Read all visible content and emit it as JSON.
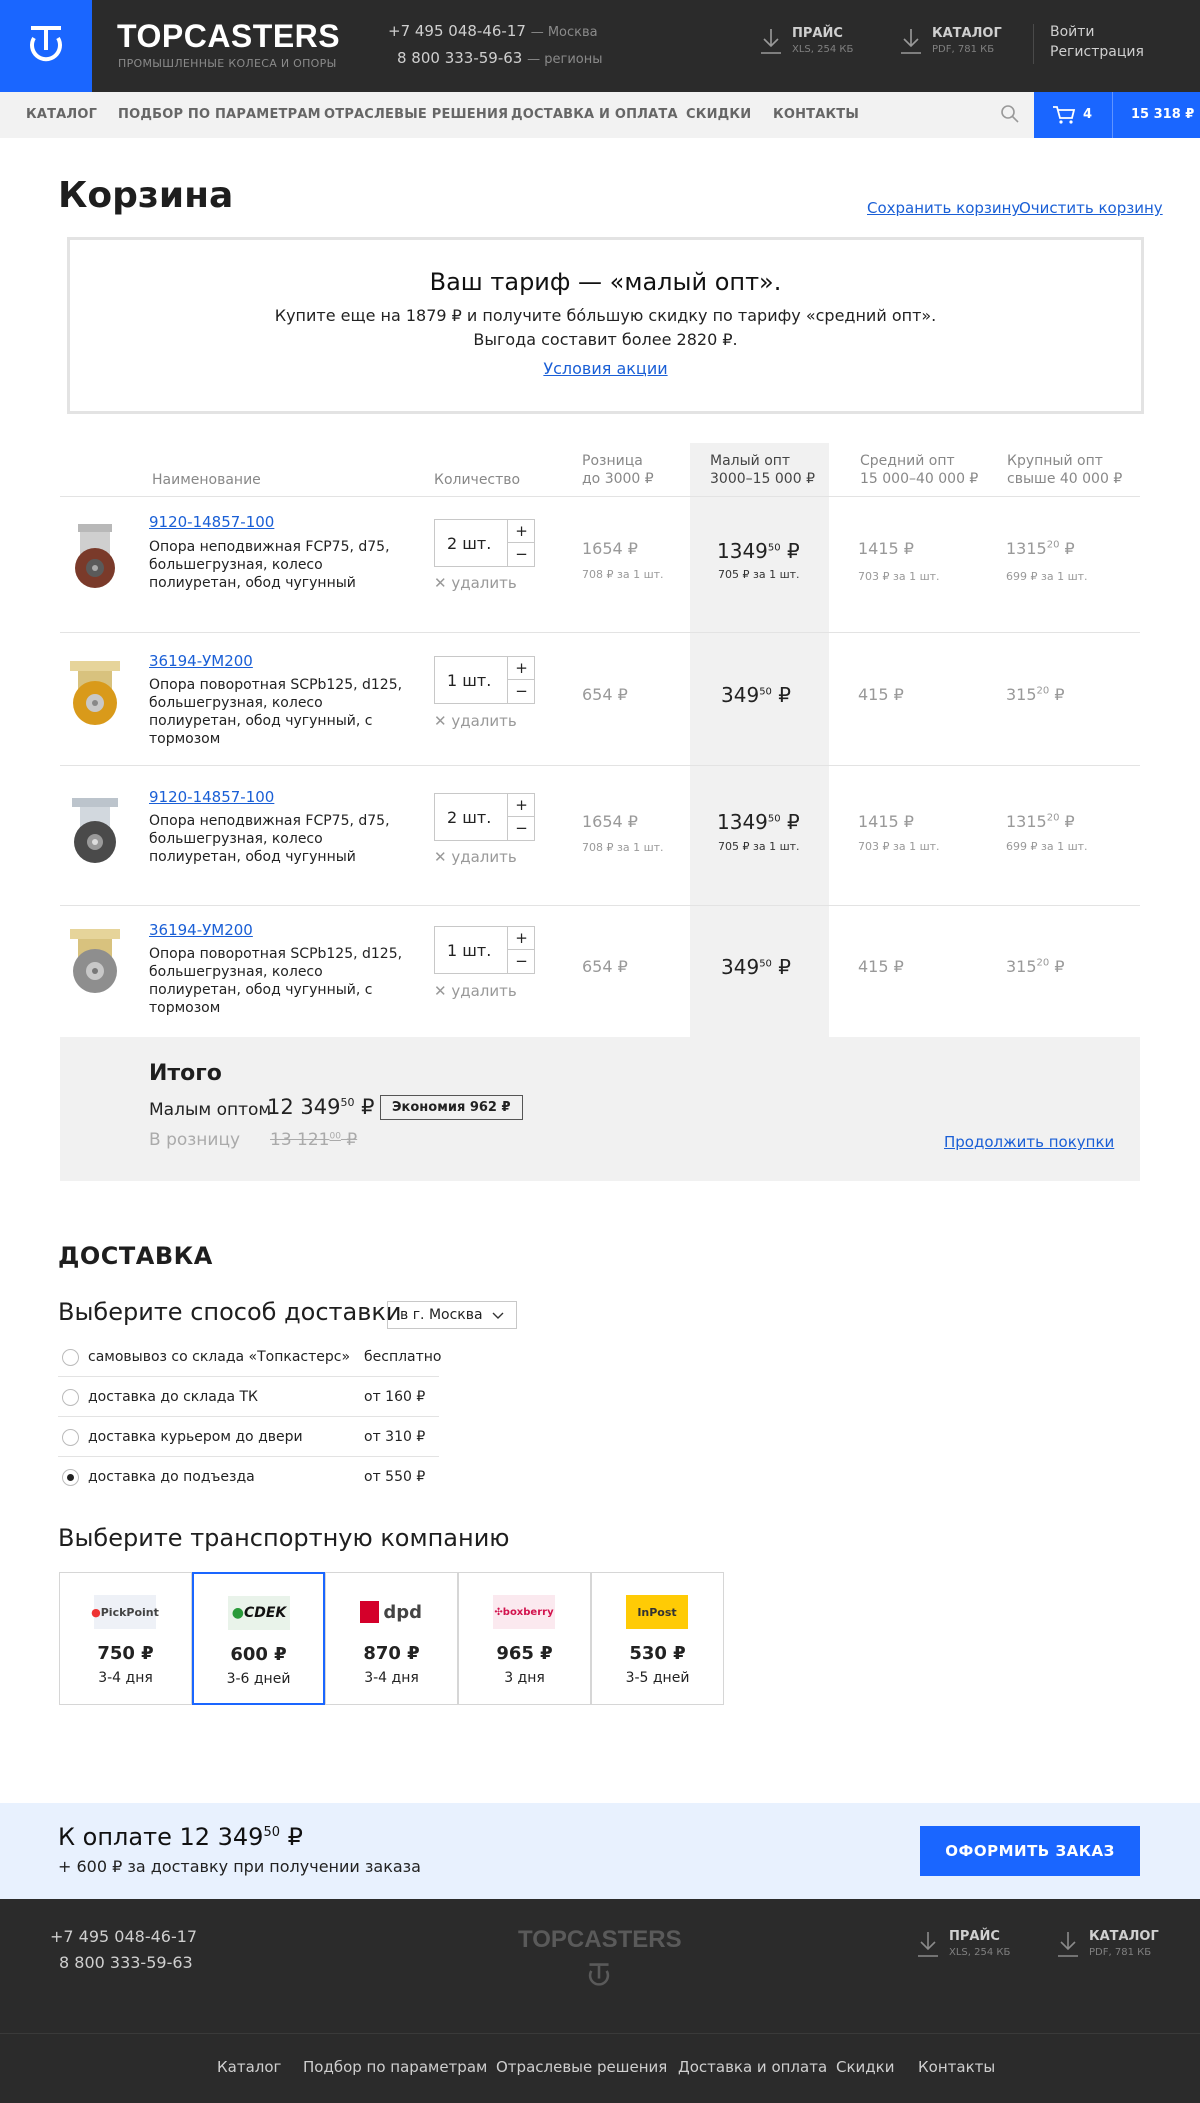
{
  "header": {
    "brand": "TOPCASTERS",
    "brand_sub": "ПРОМЫШЛЕННЫЕ КОЛЕСА И ОПОРЫ",
    "phone1": "+7 495 048-46-17",
    "phone1_city": "— Москва",
    "phone2": "8 800 333-59-63",
    "phone2_city": "— регионы",
    "price_label": "ПРАЙС",
    "price_sub": "XLS, 254 КБ",
    "catalog_label": "КАТАЛОГ",
    "catalog_sub": "PDF, 781 КБ",
    "login": "Войти",
    "register": "Регистрация"
  },
  "nav": {
    "items": [
      "КАТАЛОГ",
      "ПОДБОР ПО ПАРАМЕТРАМ",
      "ОТРАСЛЕВЫЕ РЕШЕНИЯ",
      "ДОСТАВКА И ОПЛАТА",
      "СКИДКИ",
      "КОНТАКТЫ"
    ],
    "cart_count": "4",
    "cart_sum": "15 318 ₽"
  },
  "page": {
    "title": "Корзина",
    "save_cart": "Сохранить корзину",
    "clear_cart": "Очистить корзину"
  },
  "tariff": {
    "title": "Ваш тариф — «малый опт».",
    "line1": "Купите еще на 1879 ₽ и получите бо́льшую скидку по тарифу «средний опт».",
    "line2": "Выгода составит более 2820 ₽.",
    "link": "Условия акции"
  },
  "table": {
    "col_name": "Наименование",
    "col_qty": "Количество",
    "col_retail_1": "Розница",
    "col_retail_2": "до 3000 ₽",
    "col_small_1": "Малый опт",
    "col_small_2": "3000–15 000 ₽",
    "col_mid_1": "Средний опт",
    "col_mid_2": "15 000–40 000 ₽",
    "col_large_1": "Крупный опт",
    "col_large_2": "свыше 40 000 ₽",
    "delete_label": "удалить",
    "rows": [
      {
        "article": "9120-14857-100",
        "name": "Опора неподвижная FCP75, d75, большегрузная, колесо полиуретан, обод чугунный",
        "qty": "2 шт.",
        "retail": "1654 ₽",
        "retail_unit": "708 ₽ за 1 шт.",
        "small": "1349",
        "small_dec": "50",
        "small_unit": "705 ₽ за 1 шт.",
        "mid": "1415 ₽",
        "mid_unit": "703 ₽ за 1 шт.",
        "large": "1315",
        "large_dec": "20",
        "large_unit": "699 ₽ за 1 шт."
      },
      {
        "article": "36194-УМ200",
        "name": "Опора поворотная SCPb125, d125, большегрузная, колесо полиуретан, обод чугунный, с тормозом",
        "qty": "1 шт.",
        "retail": "654 ₽",
        "small": "349",
        "small_dec": "50",
        "mid": "415 ₽",
        "large": "315",
        "large_dec": "20"
      },
      {
        "article": "9120-14857-100",
        "name": "Опора неподвижная FCP75, d75, большегрузная, колесо полиуретан, обод чугунный",
        "qty": "2 шт.",
        "retail": "1654 ₽",
        "retail_unit": "708 ₽ за 1 шт.",
        "small": "1349",
        "small_dec": "50",
        "small_unit": "705 ₽ за 1 шт.",
        "mid": "1415 ₽",
        "mid_unit": "703 ₽ за 1 шт.",
        "large": "1315",
        "large_dec": "20",
        "large_unit": "699 ₽ за 1 шт."
      },
      {
        "article": "36194-УМ200",
        "name": "Опора поворотная SCPb125, d125, большегрузная, колесо полиуретан, обод чугунный, с тормозом",
        "qty": "1 шт.",
        "retail": "654 ₽",
        "small": "349",
        "small_dec": "50",
        "mid": "415 ₽",
        "large": "315",
        "large_dec": "20"
      }
    ]
  },
  "total": {
    "title": "Итого",
    "small_label": "Малым оптом",
    "small_value": "12 349",
    "small_dec": "50",
    "savings": "Экономия 962 ₽",
    "retail_label": "В розницу",
    "retail_value": "13 121",
    "retail_dec": "00",
    "continue": "Продолжить покупки"
  },
  "delivery": {
    "title": "ДОСТАВКА",
    "choose_method": "Выберите способ доставки",
    "city": "в г. Москва",
    "options": [
      {
        "label": "самовывоз со склада «Топкастерс»",
        "price": "бесплатно",
        "selected": false
      },
      {
        "label": "доставка до склада ТК",
        "price": "от 160 ₽",
        "selected": false
      },
      {
        "label": "доставка курьером до двери",
        "price": "от 310 ₽",
        "selected": false
      },
      {
        "label": "доставка до подъезда",
        "price": "от 550 ₽",
        "selected": true
      }
    ],
    "choose_carrier": "Выберите транспортную компанию",
    "carriers": [
      {
        "logo": "PickPoint",
        "price": "750 ₽",
        "days": "3-4 дня"
      },
      {
        "logo": "CDEK",
        "price": "600 ₽",
        "days": "3-6 дней"
      },
      {
        "logo": "dpd",
        "price": "870 ₽",
        "days": "3-4 дня"
      },
      {
        "logo": "boxberry",
        "price": "965 ₽",
        "days": "3 дня"
      },
      {
        "logo": "InPost",
        "price": "530 ₽",
        "days": "3-5 дней"
      }
    ]
  },
  "pay": {
    "label": "К оплате 12 349",
    "dec": "50",
    "currency": " ₽",
    "note": "+ 600 ₽ за доставку при получении заказа",
    "button": "ОФОРМИТЬ ЗАКАЗ"
  },
  "footer": {
    "phone1": "+7 495 048-46-17",
    "phone2": "8 800 333-59-63",
    "brand": "TOPCASTERS",
    "price_label": "ПРАЙС",
    "price_sub": "XLS, 254 КБ",
    "catalog_label": "КАТАЛОГ",
    "catalog_sub": "PDF, 781 КБ",
    "links": [
      "Каталог",
      "Подбор по параметрам",
      "Отраслевые решения",
      "Доставка и оплата",
      "Скидки",
      "Контакты"
    ]
  },
  "colors": {
    "accent": "#1a66ff",
    "dark": "#2b2b2b",
    "link": "#1a5fd6"
  }
}
